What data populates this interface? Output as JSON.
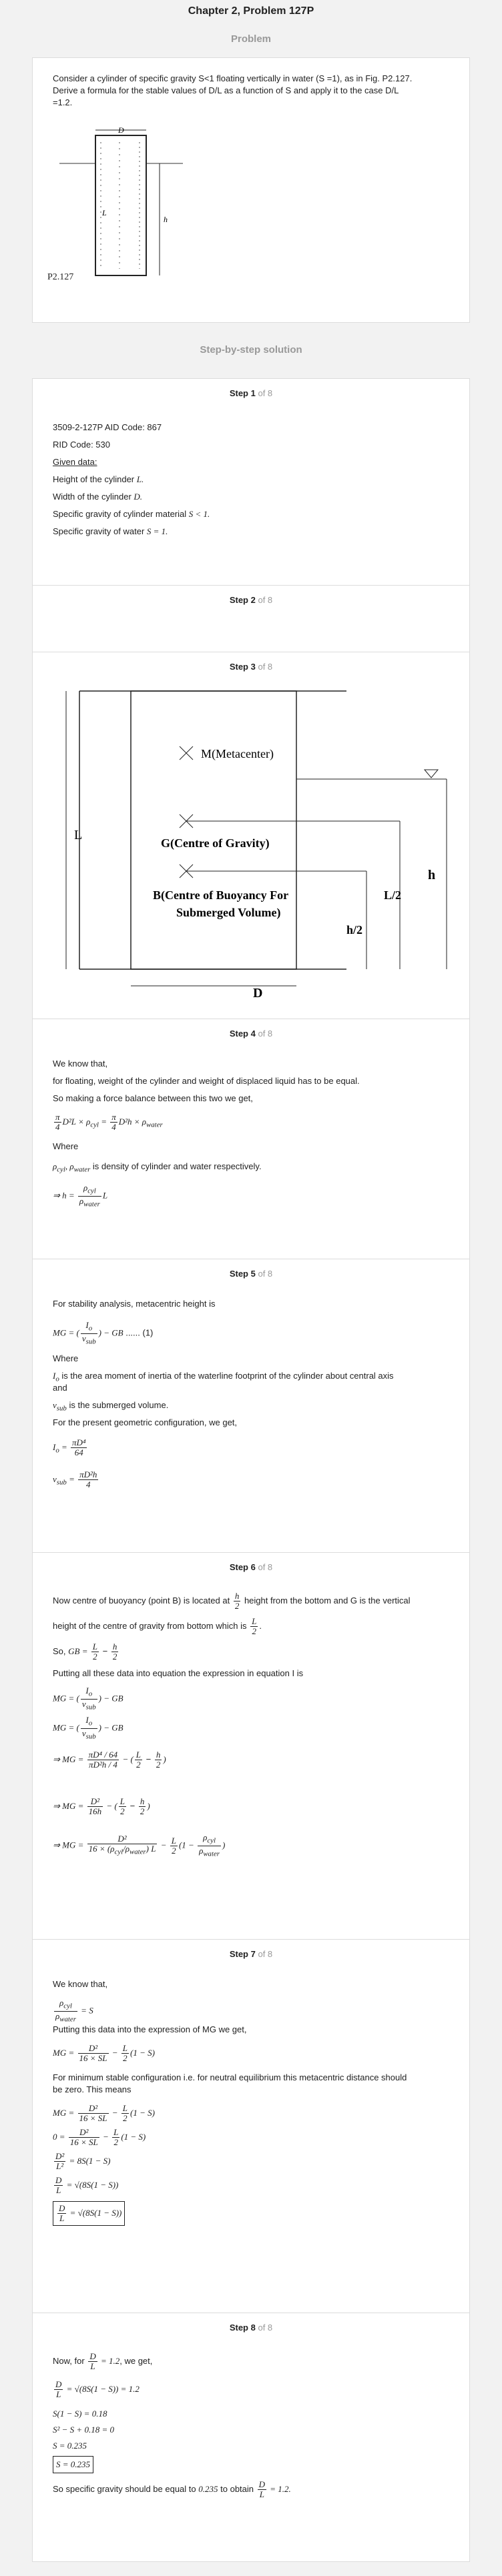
{
  "header": {
    "title": "Chapter 2, Problem 127P",
    "subtitle": "Problem"
  },
  "problem": {
    "line1": "Consider a cylinder of specific gravity S<1 floating vertically in water (S =1), as in Fig. P2.127.",
    "line2": "Derive a formula for the stable values of D/L as a function of S and apply it to the case D/L",
    "line3": "=1.2.",
    "fig_label": "P2.127",
    "fig_D": "D",
    "fig_L": "L",
    "fig_h": "h"
  },
  "solution_title": "Step-by-step solution",
  "of_text": "of 8",
  "steps": {
    "s1": {
      "label": "Step 1",
      "l1": "3509-2-127P AID Code: 867",
      "l2": "RID Code: 530",
      "l3": "Given data:",
      "l4": "Height of the cylinder",
      "l4m": "L.",
      "l5": "Width of the cylinder",
      "l5m": "D.",
      "l6": "Specific gravity of cylinder material",
      "l6m": "S < 1.",
      "l7": "Specific gravity of water",
      "l7m": "S = 1."
    },
    "s2": {
      "label": "Step 2"
    },
    "s3": {
      "label": "Step 3",
      "m": "M(Metacenter)",
      "g": "G(Centre of Gravity)",
      "b1": "B(Centre of Buoyancy For",
      "b2": "Submerged Volume)",
      "L": "L",
      "D": "D",
      "h": "h",
      "L2": "L/2",
      "h2": "h/2"
    },
    "s4": {
      "label": "Step 4",
      "l1": "We know that,",
      "l2": "for floating, weight of the cylinder and weight of displaced liquid has to be equal.",
      "l3": "So making a force balance between this two we get,",
      "l4": "Where",
      "l5": "is density of cylinder and water respectively."
    },
    "s5": {
      "label": "Step 5",
      "l1": "For stability analysis, metacentric height is",
      "l2": "Where",
      "l3": "is the area moment of inertia of the waterline footprint of the cylinder about central axis",
      "l3b": "and",
      "l4": "is the submerged volume.",
      "l5": "For the present geometric configuration, we get,"
    },
    "s6": {
      "label": "Step 6",
      "l1a": "Now centre of buoyancy (point B) is located at",
      "l1b": "height from the bottom and G is the vertical",
      "l2": "height of the centre of gravity from bottom which is",
      "l3": "So,",
      "l4": "Putting all these data into equation the expression in equation I is"
    },
    "s7": {
      "label": "Step 7",
      "l1": "We know that,",
      "l2": "Putting this data into the expression of MG we get,",
      "l3": "For minimum stable configuration i.e. for neutral equilibrium this metacentric distance should",
      "l3b": "be zero. This means"
    },
    "s8": {
      "label": "Step 8",
      "l1": "Now, for",
      "l1b": ", we get,",
      "l2": "So specific gravity should be equal to",
      "l2b": "to obtain",
      "val": "0.235"
    }
  }
}
